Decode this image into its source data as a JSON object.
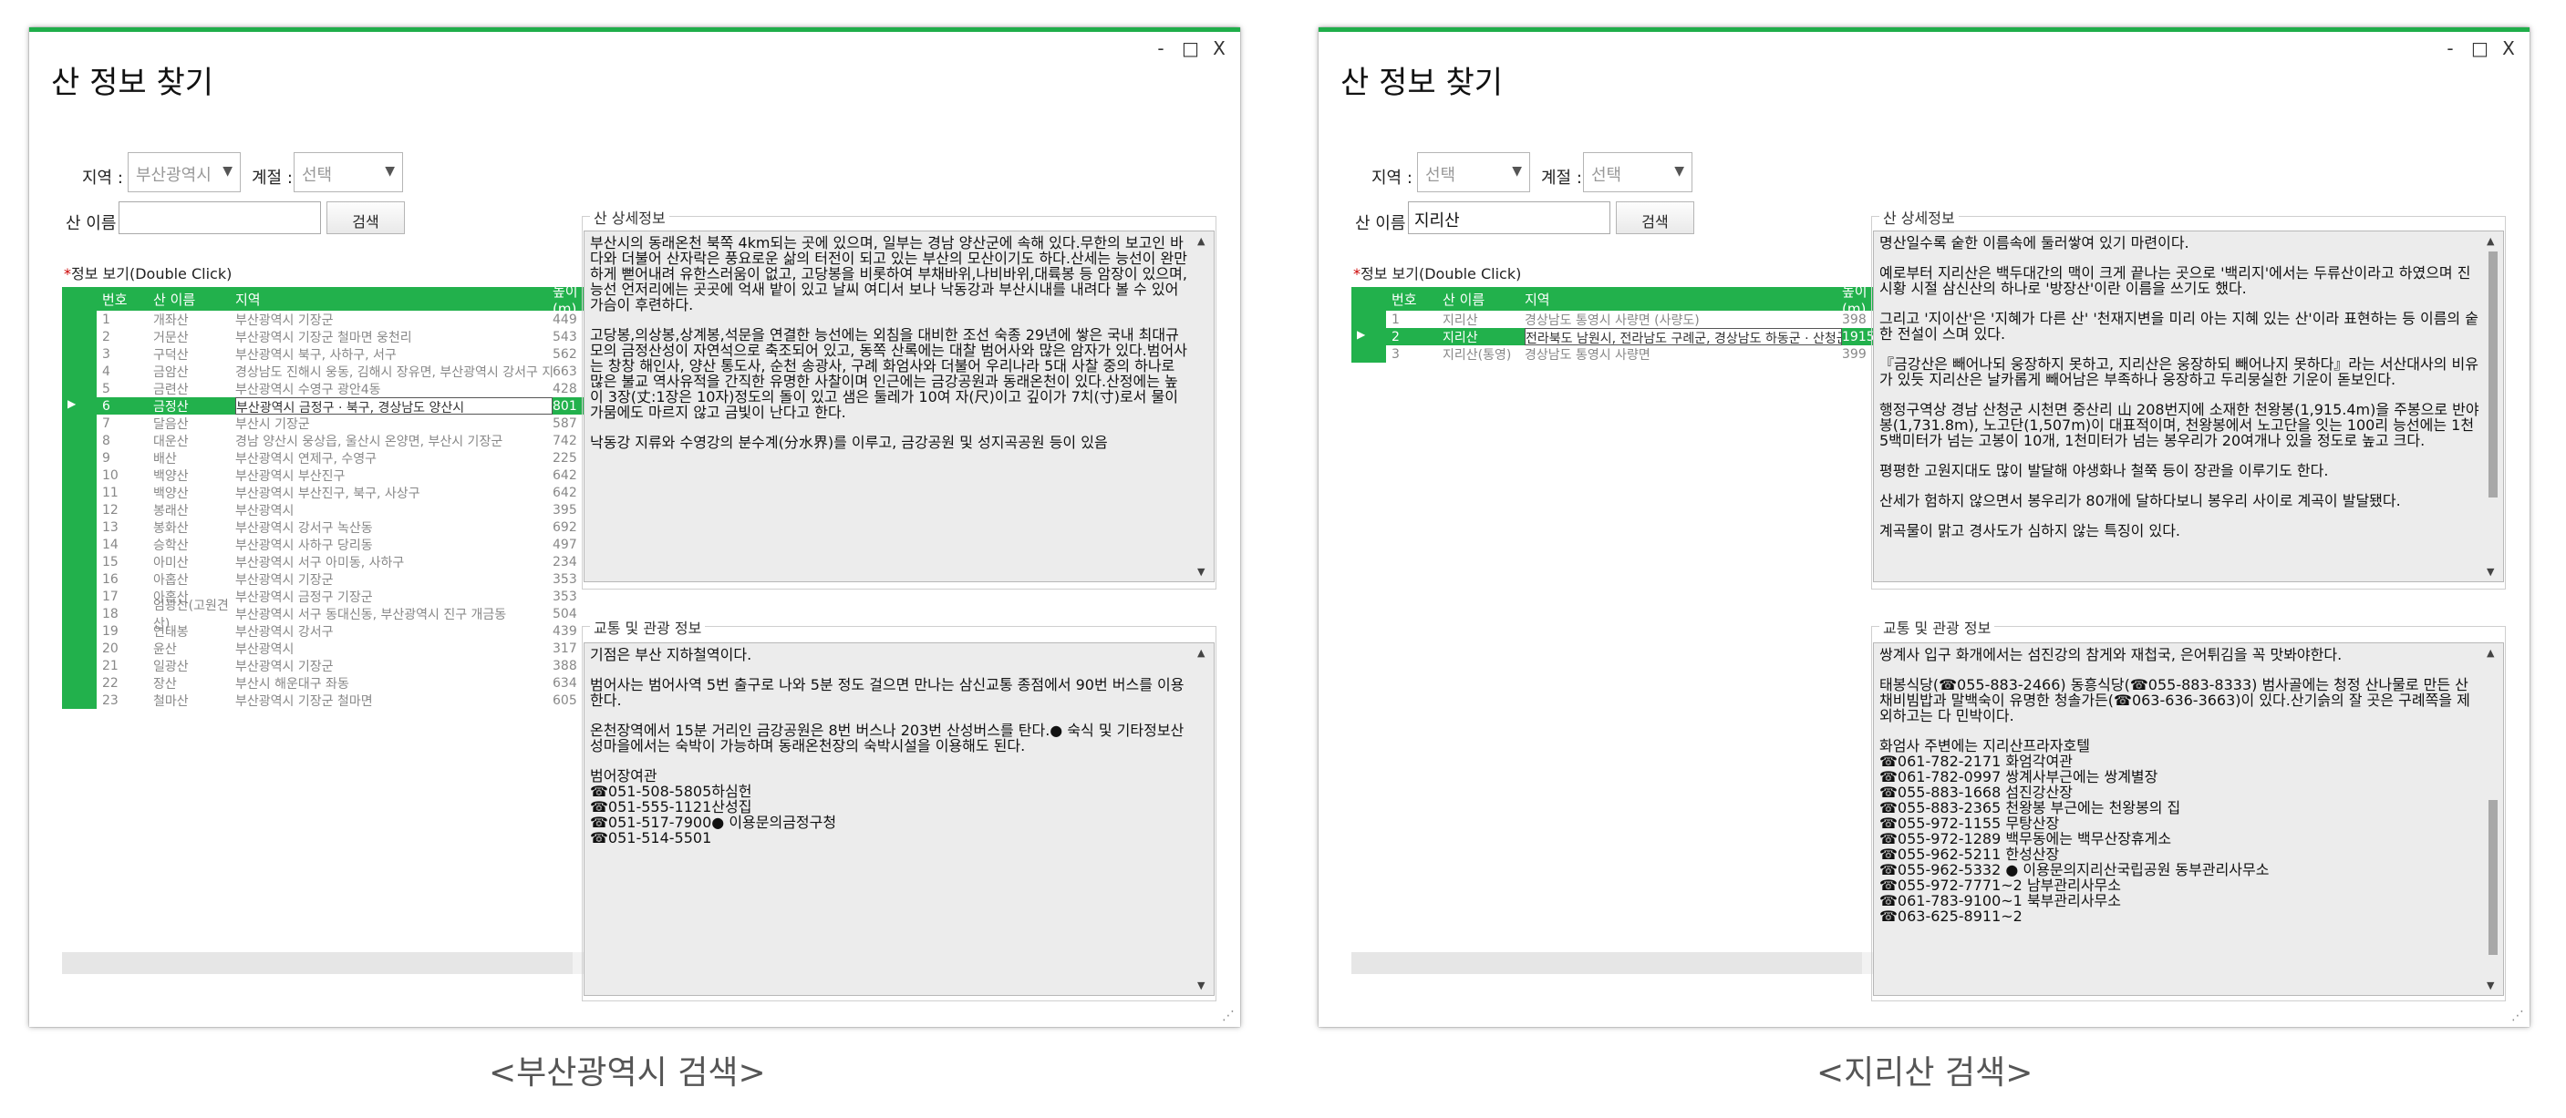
{
  "windows": [
    {
      "title": "산 정보 찾기",
      "controls": {
        "minimize": "-",
        "maximize": "□",
        "close": "X"
      },
      "region_label": "지역 :",
      "region_value": "부산광역시",
      "season_label": "계절 :",
      "season_value": "선택",
      "name_label": "산 이름 :",
      "name_value": "",
      "search_button": "검색",
      "view_label_mark": "*",
      "view_label": "정보 보기(Double Click)",
      "grid_headers": {
        "no": "번호",
        "name": "산 이름",
        "loc": "지역",
        "height": "높이(m)"
      },
      "rows": [
        {
          "no": "1",
          "name": "개좌산",
          "loc": "부산광역시 기장군",
          "h": "449"
        },
        {
          "no": "2",
          "name": "거문산",
          "loc": "부산광역시 기장군 철마면 웅천리",
          "h": "543"
        },
        {
          "no": "3",
          "name": "구덕산",
          "loc": "부산광역시 북구, 사하구, 서구",
          "h": "562"
        },
        {
          "no": "4",
          "name": "금암산",
          "loc": "경상남도 진해시 웅동, 김해시 장유면, 부산광역시 강서구 지사동",
          "h": "663"
        },
        {
          "no": "5",
          "name": "금련산",
          "loc": "부산광역시 수영구 광안4동",
          "h": "428"
        },
        {
          "no": "6",
          "name": "금정산",
          "loc": "부산광역시 금정구 · 북구, 경상남도 양산시",
          "h": "801"
        },
        {
          "no": "7",
          "name": "달음산",
          "loc": "부산시 기장군",
          "h": "587"
        },
        {
          "no": "8",
          "name": "대운산",
          "loc": "경남 양산시 웅상읍, 울산시 온양면, 부산시 기장군",
          "h": "742"
        },
        {
          "no": "9",
          "name": "배산",
          "loc": "부산광역시 연제구, 수영구",
          "h": "225"
        },
        {
          "no": "10",
          "name": "백양산",
          "loc": "부산광역시 부산진구",
          "h": "642"
        },
        {
          "no": "11",
          "name": "백양산",
          "loc": "부산광역시 부산진구, 북구, 사상구",
          "h": "642"
        },
        {
          "no": "12",
          "name": "봉래산",
          "loc": "부산광역시",
          "h": "395"
        },
        {
          "no": "13",
          "name": "봉화산",
          "loc": "부산광역시 강서구 녹산동",
          "h": "692"
        },
        {
          "no": "14",
          "name": "승학산",
          "loc": "부산광역시 사하구 당리동",
          "h": "497"
        },
        {
          "no": "15",
          "name": "아미산",
          "loc": "부산광역시 서구 아미동, 사하구",
          "h": "234"
        },
        {
          "no": "16",
          "name": "아홉산",
          "loc": "부산광역시 기장군",
          "h": "353"
        },
        {
          "no": "17",
          "name": "아홉산",
          "loc": "부산광역시 금정구 기장군",
          "h": "353"
        },
        {
          "no": "18",
          "name": "엄광산(고원견산)",
          "loc": "부산광역시 서구 동대신동, 부산광역시 진구 개금동",
          "h": "504"
        },
        {
          "no": "19",
          "name": "연태봉",
          "loc": "부산광역시 강서구",
          "h": "439"
        },
        {
          "no": "20",
          "name": "윤산",
          "loc": "부산광역시",
          "h": "317"
        },
        {
          "no": "21",
          "name": "일광산",
          "loc": "부산광역시 기장군",
          "h": "388"
        },
        {
          "no": "22",
          "name": "장산",
          "loc": "부산시 해운대구 좌동",
          "h": "634"
        },
        {
          "no": "23",
          "name": "철마산",
          "loc": "부산광역시 기장군 철마면",
          "h": "605"
        }
      ],
      "detail_title": "산 상세정보",
      "detail_paragraphs": [
        "부산시의 동래온천 북쪽 4km되는 곳에 있으며, 일부는 경남 양산군에 속해 있다.무한의 보고인 바다와 더불어 산자락은 풍요로운 삶의 터전이 되고 있는 부산의 모산이기도 하다.산세는 능선이 완만하게 뻗어내려 유한스러움이 없고, 고당봉을 비롯하여 부채바위,나비바위,대륙봉 등 암장이 있으며, 능선 언저리에는 곳곳에 억새 밭이 있고 날씨 여디서 보나 낙동강과 부산시내를 내려다 볼 수 있어 가슴이 후련하다.",
        "고당봉,의상봉,상계봉,석문을 연결한 능선에는 외침을 대비한 조선 숙종 29년에 쌓은 국내 최대규모의 금정산성이 자연석으로 축조되어 있고, 동쪽 산록에는 대찰 범어사와 많은 암자가 있다.범어사는 창창 해인사, 양산 통도사, 순천 송광사, 구례 화엄사와 더불어 우리나라 5대 사찰 중의 하나로 많은 불교 역사유적을 간직한 유명한 사찰이며 인근에는 금강공원과 동래온천이 있다.산정에는 높이 3장(丈:1장은 10자)정도의 돌이 있고 샘은 둘레가 10여 자(尺)이고 깊이가 7치(寸)로서 물이 가뭄에도 마르지 않고 금빛이 난다고 한다.",
        "낙동강 지류와 수영강의 분수계(分水界)를 이루고, 금강공원 및 성지곡공원 등이 있음"
      ],
      "transport_title": "교통 및 관광 정보",
      "transport_paragraphs": [
        "기점은 부산 지하철역이다.",
        "범어사는 범어사역 5번 출구로 나와 5분 정도 걸으면 만나는 삼신교통 종점에서 90번 버스를 이용한다.",
        "온천장역에서 15분 거리인 금강공원은 8번 버스나 203번 산성버스를 탄다.● 숙식 및 기타정보산성마을에서는 숙박이 가능하며 동래온천장의 숙박시설을 이용해도 된다.",
        "범어장여관\n☎051-508-5805하심헌\n☎051-555-1121산성집\n☎051-517-7900● 이용문의금정구청\n☎051-514-5501"
      ],
      "caption": "<부산광역시 검색>"
    },
    {
      "title": "산 정보 찾기",
      "controls": {
        "minimize": "-",
        "maximize": "□",
        "close": "X"
      },
      "region_label": "지역 :",
      "region_value": "선택",
      "season_label": "계절 :",
      "season_value": "선택",
      "name_label": "산 이름 :",
      "name_value": "지리산",
      "search_button": "검색",
      "view_label_mark": "*",
      "view_label": "정보 보기(Double Click)",
      "grid_headers": {
        "no": "번호",
        "name": "산 이름",
        "loc": "지역",
        "height": "높이(m)"
      },
      "rows": [
        {
          "no": "1",
          "name": "지리산",
          "loc": "경상남도 통영시 사량면 (사량도)",
          "h": "398"
        },
        {
          "no": "2",
          "name": "지리산",
          "loc": "전라북도 남원시, 전라남도 구례군, 경상남도 하동군 · 산청군 · 함양군",
          "h": "1915"
        },
        {
          "no": "3",
          "name": "지리산(통영)",
          "loc": "경상남도 통영시 사량면",
          "h": "399"
        }
      ],
      "detail_title": "산 상세정보",
      "detail_paragraphs": [
        "명산일수록 숱한 이름속에 둘러쌓여 있기 마련이다.",
        "예로부터 지리산은 백두대간의 맥이 크게 끝나는 곳으로 '백리지'에서는 두류산이라고 하였으며 진시황 시절 삼신산의 하나로 '방장산'이란 이름을 쓰기도 했다.",
        "그리고 '지이산'은 '지혜가 다른 산' '천재지변을 미리 아는 지혜 있는 산'이라 표현하는 등 이름의 숱한 전설이 스며 있다.",
        "『금강산은 빼어나되 웅장하지 못하고, 지리산은 웅장하되 빼어나지 못하다』라는 서산대사의 비유가 있듯 지리산은 날카롭게 빼어남은 부족하나 웅장하고 두리뭉실한 기운이 돋보인다.",
        "행정구역상 경남 산청군 시천면 중산리 山 208번지에 소재한 천왕봉(1,915.4m)을 주봉으로 반야봉(1,731.8m), 노고단(1,507m)이 대표적이며, 천왕봉에서 노고단을 잇는 100리 능선에는 1천 5백미터가 넘는 고봉이 10개, 1천미터가 넘는 봉우리가 20여개나 있을 정도로 높고 크다.",
        "평평한 고원지대도 많이 발달해 야생화나 철쭉 등이 장관을 이루기도 한다.",
        "산세가 험하지 않으면서 봉우리가 80개에 달하다보니 봉우리 사이로 계곡이 발달됐다.",
        "계곡물이 맑고 경사도가 심하지 않는 특징이 있다."
      ],
      "transport_title": "교통 및 관광 정보",
      "transport_paragraphs": [
        "쌍계사 입구 화개에서는 섬진강의 참게와 재첩국, 은어튀김을 꼭 맛봐야한다.",
        "태봉식당(☎055-883-2466) 동흥식당(☎055-883-8333) 범사골에는 청정 산나물로 만든 산채비빔밥과 말백숙이 유명한 청솔가든(☎063-636-3663)이 있다.산기슭의 잘 곳은 구례쪽을 제외하고는 다 민박이다.",
        "화엄사 주변에는 지리산프라자호텔\n☎061-782-2171 화엄각여관\n☎061-782-0997 쌍계사부근에는 쌍계별장\n☎055-883-1668 섬진강산장\n☎055-883-2365 천왕봉 부근에는 천왕봉의 집\n☎055-972-1155 무탕산장\n☎055-972-1289 백무동에는 백무산장휴게소\n☎055-962-5211 한성산장\n☎055-962-5332 ● 이용문의지리산국립공원 동부관리사무소\n☎055-972-7771~2 남부관리사무소\n☎061-783-9100~1 북부관리사무소\n☎063-625-8911~2"
      ],
      "caption": "<지리산 검색>"
    }
  ]
}
